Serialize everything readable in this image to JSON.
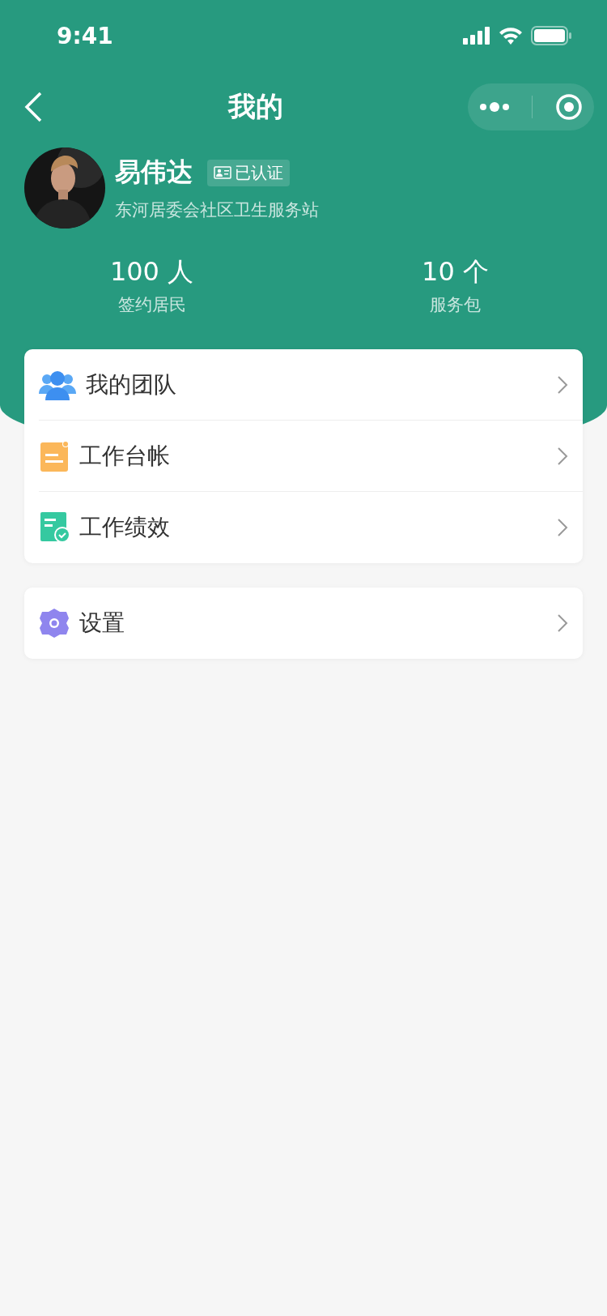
{
  "status_bar": {
    "time": "9:41"
  },
  "nav": {
    "title": "我的"
  },
  "profile": {
    "name": "易伟达",
    "badge": "已认证",
    "organization": "东河居委会社区卫生服务站"
  },
  "stats": [
    {
      "value": "100 人",
      "label": "签约居民"
    },
    {
      "value": "10 个",
      "label": "服务包"
    }
  ],
  "menu_groups": [
    {
      "items": [
        {
          "kind": "team",
          "label": "我的团队"
        },
        {
          "kind": "ledger",
          "label": "工作台帐"
        },
        {
          "kind": "performance",
          "label": "工作绩效"
        }
      ]
    },
    {
      "items": [
        {
          "kind": "settings",
          "label": "设置"
        }
      ]
    }
  ]
}
